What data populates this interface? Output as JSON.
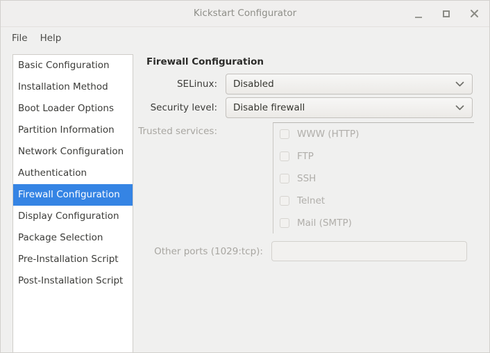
{
  "window": {
    "title": "Kickstart Configurator",
    "controls": [
      {
        "name": "minimize",
        "glyph": "_"
      },
      {
        "name": "maximize",
        "glyph": "□"
      },
      {
        "name": "close",
        "glyph": "×"
      }
    ]
  },
  "menubar": {
    "items": [
      {
        "label": "File"
      },
      {
        "label": "Help"
      }
    ]
  },
  "sidebar": {
    "selected_index": 6,
    "items": [
      {
        "label": "Basic Configuration"
      },
      {
        "label": "Installation Method"
      },
      {
        "label": "Boot Loader Options"
      },
      {
        "label": "Partition Information"
      },
      {
        "label": "Network Configuration"
      },
      {
        "label": "Authentication"
      },
      {
        "label": "Firewall Configuration"
      },
      {
        "label": "Display Configuration"
      },
      {
        "label": "Package Selection"
      },
      {
        "label": "Pre-Installation Script"
      },
      {
        "label": "Post-Installation Script"
      }
    ]
  },
  "main": {
    "panel_title": "Firewall Configuration",
    "selinux": {
      "label": "SELinux:",
      "value": "Disabled"
    },
    "security_level": {
      "label": "Security level:",
      "value": "Disable firewall"
    },
    "trusted_services": {
      "label": "Trusted services:",
      "items": [
        {
          "label": "WWW (HTTP)",
          "checked": false
        },
        {
          "label": "FTP",
          "checked": false
        },
        {
          "label": "SSH",
          "checked": false
        },
        {
          "label": "Telnet",
          "checked": false
        },
        {
          "label": "Mail (SMTP)",
          "checked": false
        }
      ]
    },
    "other_ports": {
      "label": "Other ports (1029:tcp):",
      "value": "",
      "placeholder": ""
    }
  },
  "colors": {
    "selection": "#3584e4",
    "window_bg": "#f0f0ef",
    "list_bg": "#ffffff",
    "text": "#3b3b38",
    "dim_text": "#a8a6a1"
  }
}
